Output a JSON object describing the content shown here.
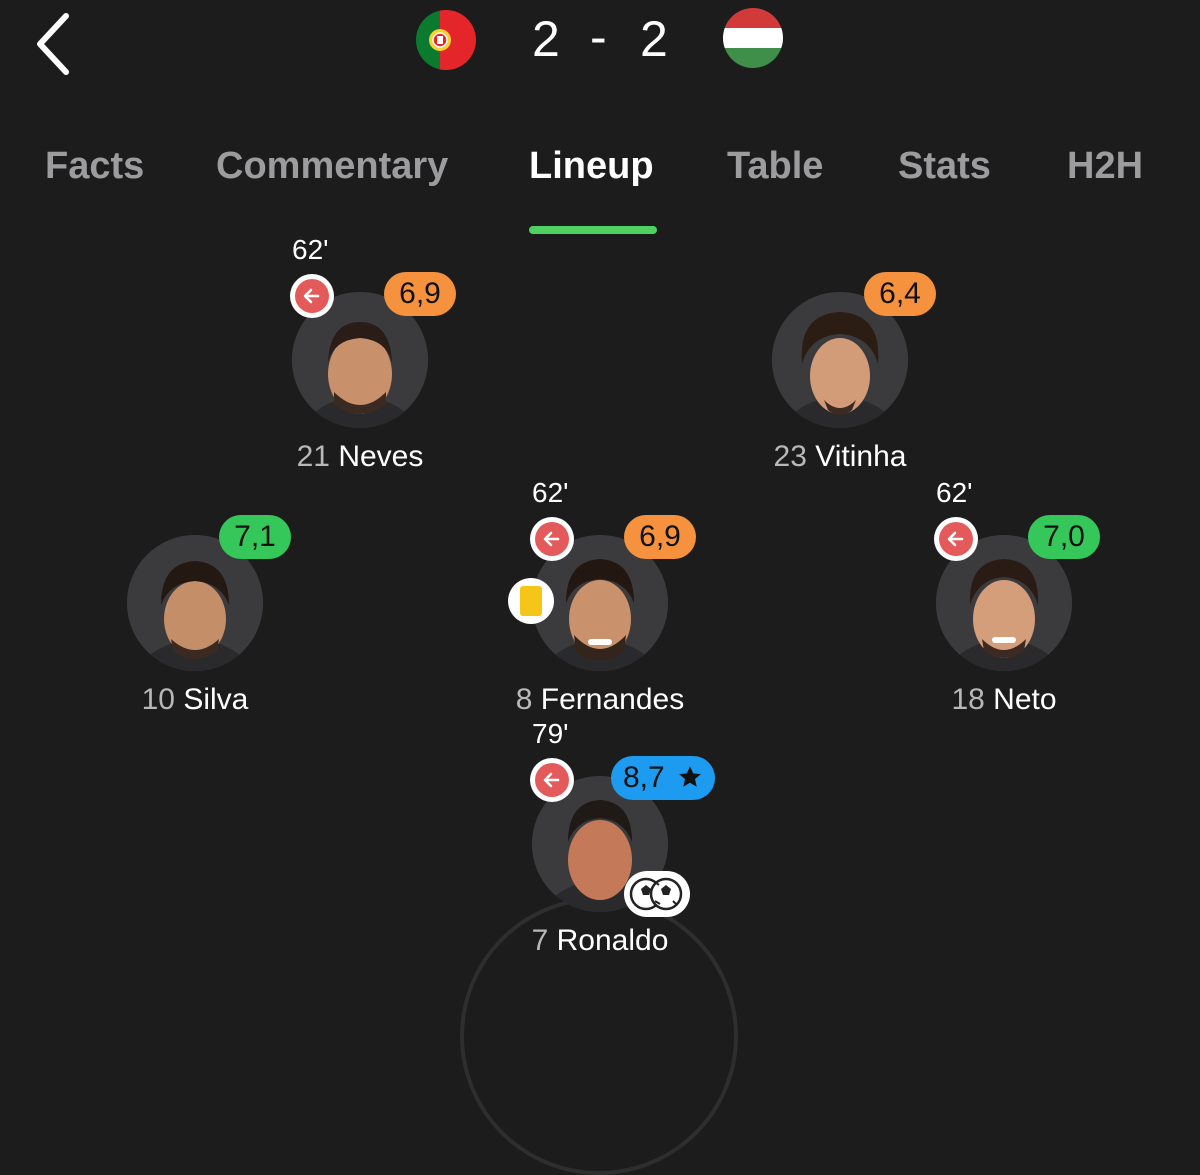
{
  "header": {
    "back_icon": "chevron-left-icon",
    "home_flag": "portugal-flag",
    "away_flag": "hungary-flag",
    "home_score": "2",
    "separator": "-",
    "away_score": "2"
  },
  "tabs": [
    {
      "label": "Facts",
      "active": false
    },
    {
      "label": "Commentary",
      "active": false
    },
    {
      "label": "Lineup",
      "active": true
    },
    {
      "label": "Table",
      "active": false
    },
    {
      "label": "Stats",
      "active": false
    },
    {
      "label": "H2H",
      "active": false
    }
  ],
  "colors": {
    "accent": "#4ed063",
    "rating_orange": "#f6923e",
    "rating_green": "#36c75b",
    "rating_blue": "#1d9bf0",
    "sub_red": "#e45a5a",
    "yellow_card": "#f5c518"
  },
  "players": [
    {
      "number": "21",
      "name": "Neves",
      "rating": "6,9",
      "rating_color": "orange",
      "sub_time": "62'",
      "subbed_off": true
    },
    {
      "number": "23",
      "name": "Vitinha",
      "rating": "6,4",
      "rating_color": "orange"
    },
    {
      "number": "10",
      "name": "Silva",
      "rating": "7,1",
      "rating_color": "green"
    },
    {
      "number": "8",
      "name": "Fernandes",
      "rating": "6,9",
      "rating_color": "orange",
      "sub_time": "62'",
      "subbed_off": true,
      "yellow_card": true
    },
    {
      "number": "18",
      "name": "Neto",
      "rating": "7,0",
      "rating_color": "green",
      "sub_time": "62'",
      "subbed_off": true
    },
    {
      "number": "7",
      "name": "Ronaldo",
      "rating": "8,7",
      "rating_icon": "star-icon",
      "rating_color": "blue",
      "sub_time": "79'",
      "subbed_off": true,
      "goals": 2
    }
  ]
}
